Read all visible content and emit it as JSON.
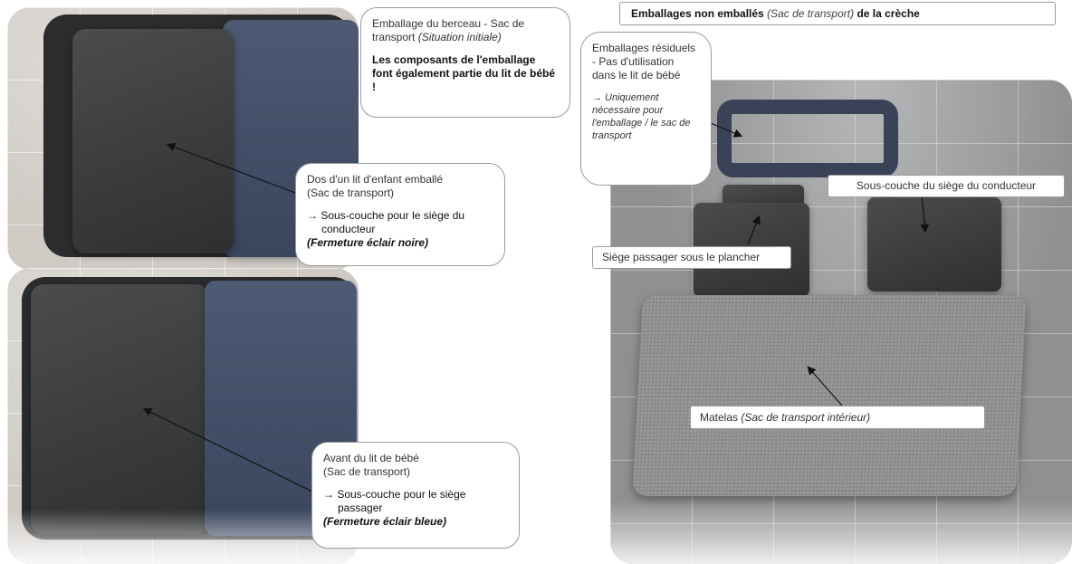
{
  "photos": {
    "top_left": "Photo: folded bed bag (top view)",
    "bottom_left": "Photo: bed bag (front)",
    "right": "Photo: unpacked components on tile floor"
  },
  "callouts": {
    "crib_packaging": {
      "title": "Emballage du berceau - Sac de transport",
      "title_italic": "(Situation initiale)",
      "note": "Les composants de l'emballage font également partie du lit de bébé !"
    },
    "back_of_bed": {
      "title": "Dos d'un lit d'enfant emballé",
      "subtitle": "(Sac de transport)",
      "arrow_text": "→ Sous-couche pour le siège du",
      "arrow_text_2": "conducteur",
      "zipper": "(Fermeture éclair noire)"
    },
    "front_of_bed": {
      "title": "Avant du lit de bébé",
      "subtitle": "(Sac de transport)",
      "arrow_text": "→ Sous-couche pour le siège",
      "arrow_text_2": "passager",
      "zipper": "(Fermeture éclair bleue)"
    },
    "residual": {
      "title": "Emballages résiduels - Pas d'utilisation dans le lit de bébé",
      "note": "→ Uniquement nécessaire pour l'emballage / le sac de transport"
    }
  },
  "header": {
    "bold": "Emballages non emballés",
    "italic": "(Sac de transport)",
    "bold_end": "de la crèche"
  },
  "labels": {
    "driver": "Sous-couche du siège du conducteur",
    "passenger": "Siège passager sous le plancher",
    "mattress": "Matelas",
    "mattress_italic": "(Sac de transport intérieur)"
  }
}
